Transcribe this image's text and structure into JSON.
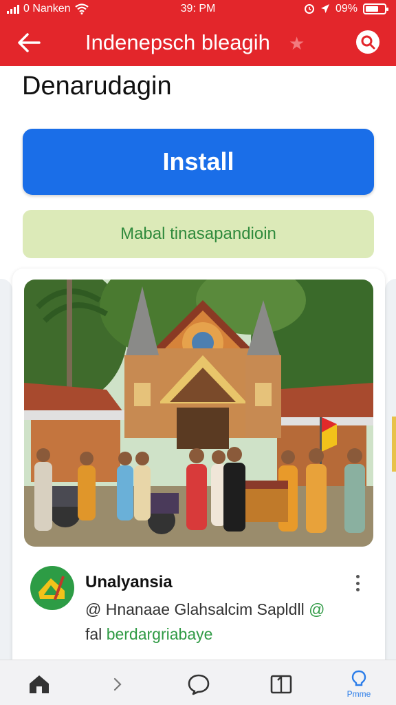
{
  "status_bar": {
    "carrier": "0 Nanken",
    "time": "39: PM",
    "battery_text": "09%"
  },
  "app_bar": {
    "title": "Indenepsch bleagih"
  },
  "page": {
    "heading": "Denarudagin"
  },
  "buttons": {
    "install_label": "Install",
    "secondary_label": "Mabal tinasapandioin"
  },
  "card": {
    "app_name": "Unalyansia",
    "description_line1_prefix": "@ Hnanaae Glahsalcim Sapldll",
    "description_line1_suffix": "@",
    "description_line2_prefix": "fal",
    "description_line2_link": "berdargriabaye"
  },
  "bottom_nav": {
    "items": [
      {
        "icon": "home-icon"
      },
      {
        "icon": "chevron-right-icon"
      },
      {
        "icon": "chat-bubble-icon"
      },
      {
        "icon": "book-icon"
      },
      {
        "icon": "bulb-icon",
        "label": "Pmme"
      }
    ]
  },
  "colors": {
    "header_red": "#e3262b",
    "install_blue": "#1a6ee8",
    "secondary_green_bg": "#dceab8",
    "secondary_green_text": "#2f8a3c",
    "active_nav_blue": "#2b7de9"
  }
}
